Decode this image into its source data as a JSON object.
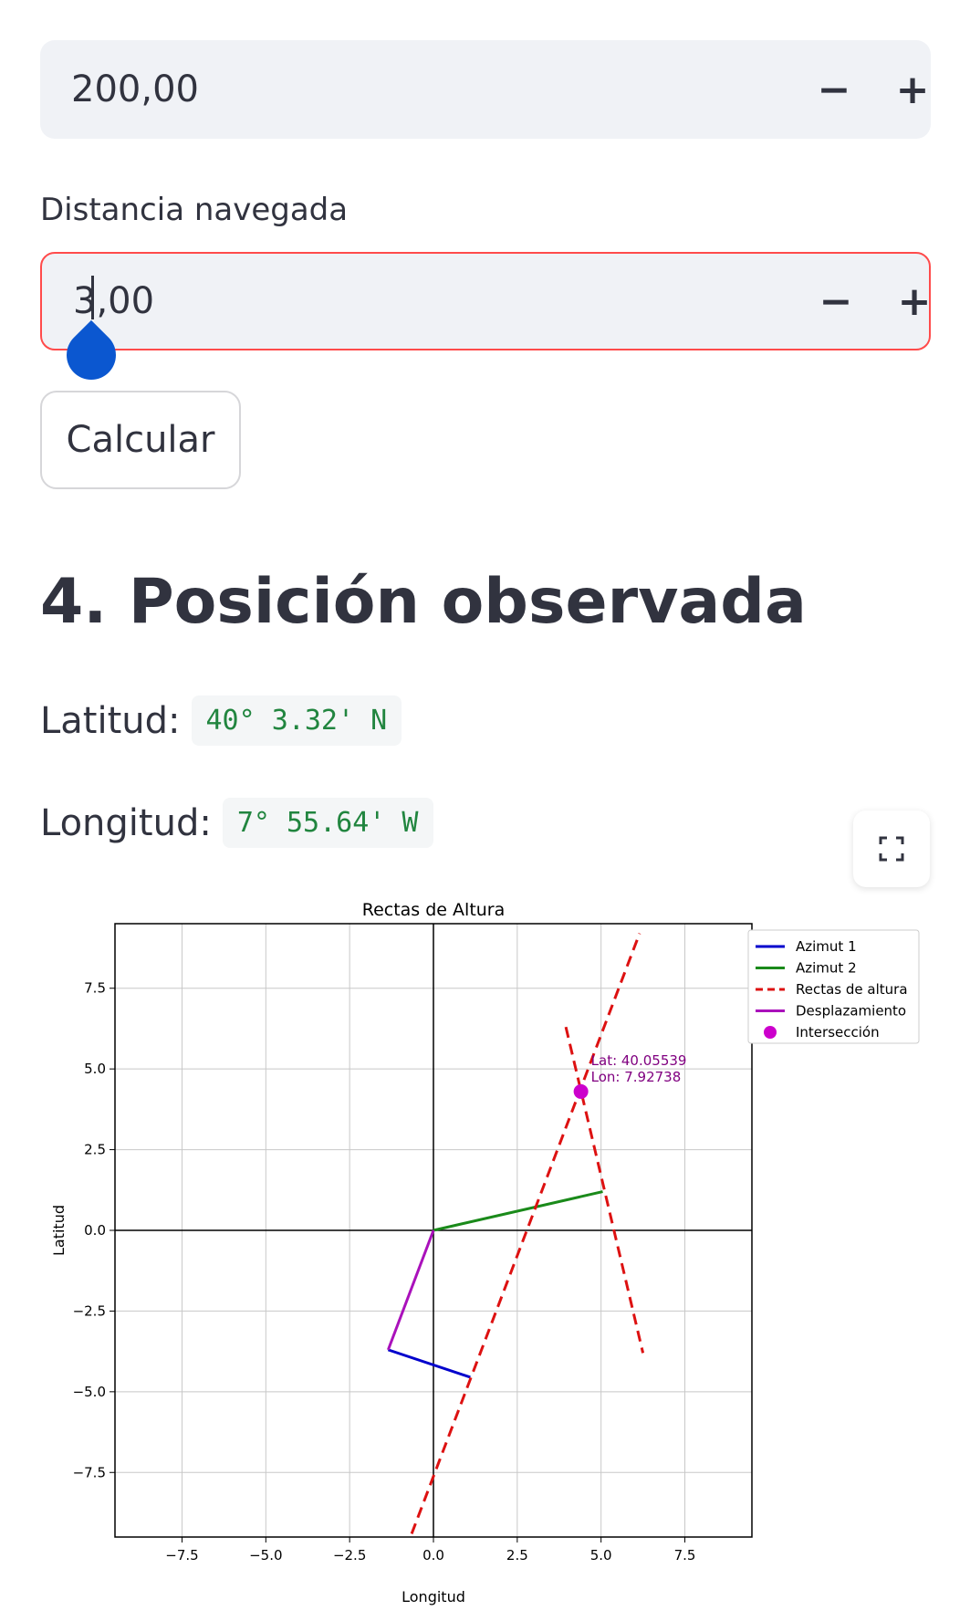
{
  "first_input": {
    "value": "200,00",
    "minus": "−",
    "plus": "+"
  },
  "second_input": {
    "label": "Distancia navegada",
    "value": "3,00",
    "minus": "−",
    "plus": "+"
  },
  "calculate_button": "Calcular",
  "section_title": "4. Posición observada",
  "latitude": {
    "label": "Latitud:",
    "value": "40° 3.32' N"
  },
  "longitude": {
    "label": "Longitud:",
    "value": "7° 55.64' W"
  },
  "colors": {
    "accent": "#ff4b4b",
    "code_text": "#21853f",
    "handle": "#0b57d0"
  },
  "chart_data": {
    "type": "line",
    "title": "Rectas de Altura",
    "xlabel": "Longitud",
    "ylabel": "Latitud",
    "xlim": [
      -9.5,
      9.5
    ],
    "ylim": [
      -9.5,
      9.5
    ],
    "xticks": [
      -7.5,
      -5.0,
      -2.5,
      0.0,
      2.5,
      5.0,
      7.5
    ],
    "yticks": [
      -7.5,
      -5.0,
      -2.5,
      0.0,
      2.5,
      5.0,
      7.5
    ],
    "xtick_labels": [
      "−7.5",
      "−5.0",
      "−2.5",
      "0.0",
      "2.5",
      "5.0",
      "7.5"
    ],
    "ytick_labels": [
      "−7.5",
      "−5.0",
      "−2.5",
      "0.0",
      "2.5",
      "5.0",
      "7.5"
    ],
    "grid": true,
    "legend_position": "top-right",
    "series": [
      {
        "name": "Azimut 1",
        "color": "#0000cc",
        "style": "solid",
        "points": [
          [
            -1.35,
            -3.7
          ],
          [
            1.1,
            -4.55
          ]
        ]
      },
      {
        "name": "Azimut 2",
        "color": "#1a8a1a",
        "style": "solid",
        "points": [
          [
            0.0,
            0.0
          ],
          [
            5.05,
            1.2
          ]
        ]
      },
      {
        "name": "Rectas de altura",
        "color": "#dd1111",
        "style": "dashed",
        "points": [
          [
            -0.65,
            -9.4
          ],
          [
            6.15,
            9.2
          ]
        ]
      },
      {
        "name": "Rectas de altura",
        "color": "#dd1111",
        "style": "dashed",
        "points": [
          [
            3.95,
            6.3
          ],
          [
            6.25,
            -3.8
          ]
        ]
      },
      {
        "name": "Desplazamiento",
        "color": "#aa11bb",
        "style": "solid",
        "points": [
          [
            0.0,
            0.0
          ],
          [
            -1.35,
            -3.7
          ]
        ]
      }
    ],
    "intersection": {
      "name": "Intersección",
      "color": "#cc00cc",
      "x": 4.4,
      "y": 4.3
    },
    "annotation": {
      "lines": [
        "Lat: 40.05539",
        "Lon: 7.92738"
      ]
    },
    "legend": [
      {
        "label": "Azimut 1",
        "color": "#0000cc",
        "kind": "line"
      },
      {
        "label": "Azimut 2",
        "color": "#1a8a1a",
        "kind": "line"
      },
      {
        "label": "Rectas de altura",
        "color": "#dd1111",
        "kind": "dashed"
      },
      {
        "label": "Desplazamiento",
        "color": "#aa11bb",
        "kind": "line"
      },
      {
        "label": "Intersección",
        "color": "#cc00cc",
        "kind": "dot"
      }
    ]
  }
}
